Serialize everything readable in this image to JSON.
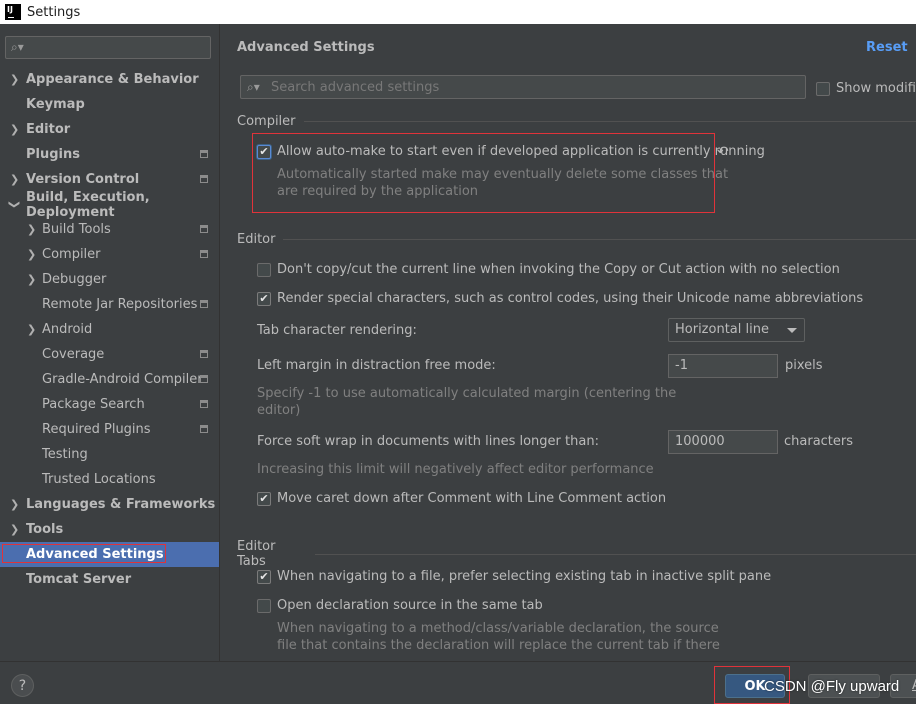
{
  "window": {
    "title": "Settings",
    "app_icon_text": "IJ"
  },
  "sidebar": {
    "search_placeholder": "",
    "items": [
      {
        "label": "Appearance & Behavior"
      },
      {
        "label": "Keymap"
      },
      {
        "label": "Editor"
      },
      {
        "label": "Plugins"
      },
      {
        "label": "Version Control"
      },
      {
        "label": "Build, Execution, Deployment"
      },
      {
        "label": "Build Tools"
      },
      {
        "label": "Compiler"
      },
      {
        "label": "Debugger"
      },
      {
        "label": "Remote Jar Repositories"
      },
      {
        "label": "Android"
      },
      {
        "label": "Coverage"
      },
      {
        "label": "Gradle-Android Compiler"
      },
      {
        "label": "Package Search"
      },
      {
        "label": "Required Plugins"
      },
      {
        "label": "Testing"
      },
      {
        "label": "Trusted Locations"
      },
      {
        "label": "Languages & Frameworks"
      },
      {
        "label": "Tools"
      },
      {
        "label": "Advanced Settings"
      },
      {
        "label": "Tomcat Server"
      }
    ],
    "selected": "Advanced Settings"
  },
  "main": {
    "title": "Advanced Settings",
    "reset_label": "Reset",
    "search_placeholder": "Search advanced settings",
    "show_modified_label": "Show modified",
    "sections": {
      "compiler": {
        "title": "Compiler",
        "auto_make_label": "Allow auto-make to start even if developed application is currently running",
        "auto_make_desc_1": "Automatically started make may eventually delete some classes that",
        "auto_make_desc_2": "are required by the application"
      },
      "editor": {
        "title": "Editor",
        "no_copy_label": "Don't copy/cut the current line when invoking the Copy or Cut action with no selection",
        "render_special_label": "Render special characters, such as control codes, using their Unicode name abbreviations",
        "tab_render_label": "Tab character rendering:",
        "tab_render_value": "Horizontal line",
        "left_margin_label": "Left margin in distraction free mode:",
        "left_margin_value": "-1",
        "left_margin_unit": "pixels",
        "left_margin_desc_1": "Specify -1 to use automatically calculated margin (centering the",
        "left_margin_desc_2": "editor)",
        "soft_wrap_label": "Force soft wrap in documents with lines longer than:",
        "soft_wrap_value": "100000",
        "soft_wrap_unit": "characters",
        "soft_wrap_desc": "Increasing this limit will negatively affect editor performance",
        "move_caret_label": "Move caret down after Comment with Line Comment action"
      },
      "editor_tabs": {
        "title": "Editor Tabs",
        "prefer_existing_label": "When navigating to a file, prefer selecting existing tab in inactive split pane",
        "open_same_tab_label": "Open declaration source in the same tab",
        "open_same_tab_desc_1": "When navigating to a method/class/variable declaration, the source",
        "open_same_tab_desc_2": "file that contains the declaration will replace the current tab if there"
      }
    },
    "checkboxes": {
      "show_modified": false,
      "auto_make": true,
      "no_copy": false,
      "render_special": true,
      "move_caret": true,
      "prefer_existing": true,
      "open_same_tab": false
    }
  },
  "footer": {
    "help_label": "?",
    "ok_label": "OK",
    "apply_label": "A",
    "watermark": "CSDN @Fly upward"
  }
}
